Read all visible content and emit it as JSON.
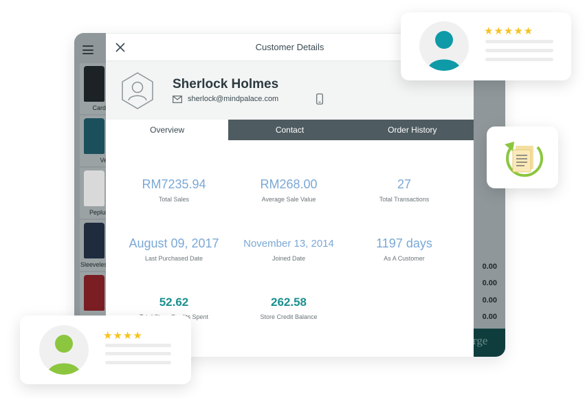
{
  "background_app": {
    "products": [
      {
        "label": "Cardi",
        "color": "#1c2226"
      },
      {
        "label": "Ve",
        "color": "#1b4f5c"
      },
      {
        "label": "Peplur",
        "color": "#d9d9d9"
      },
      {
        "label": "Sleeveles",
        "color": "#1f2c3e"
      },
      {
        "label": "",
        "color": "#7a1e23"
      }
    ],
    "values": [
      "0.00",
      "0.00",
      "0.00",
      "0.00"
    ],
    "charge_label": "rge"
  },
  "modal": {
    "title": "Customer Details",
    "customer": {
      "name": "Sherlock Holmes",
      "email": "sherlock@mindpalace.com"
    },
    "tabs": [
      {
        "label": "Overview",
        "active": true
      },
      {
        "label": "Contact",
        "active": false
      },
      {
        "label": "Order History",
        "active": false
      }
    ],
    "stats": [
      {
        "value": "RM7235.94",
        "label": "Total Sales"
      },
      {
        "value": "RM268.00",
        "label": "Average Sale Value"
      },
      {
        "value": "27",
        "label": "Total Transactions"
      },
      {
        "value": "August 09, 2017",
        "label": "Last Purchased Date"
      },
      {
        "value": "November 13, 2014",
        "label": "Joined Date"
      },
      {
        "value": "1197 days",
        "label": "As A Customer"
      },
      {
        "value": "52.62",
        "label": "Total Store Credits Spent"
      },
      {
        "value": "262.58",
        "label": "Store Credit Balance"
      }
    ]
  },
  "review_cards": {
    "top": {
      "stars": "★★★★★",
      "avatar_color": "#0e9aa7"
    },
    "bottom": {
      "stars": "★★★★",
      "avatar_color": "#8cc63f"
    }
  },
  "icons": {
    "close": "close-icon",
    "avatar": "user-hexagon-icon",
    "mail": "mail-icon",
    "phone": "phone-icon",
    "sync_document": "sync-document-icon",
    "menu": "hamburger-menu-icon"
  },
  "colors": {
    "stat_blue": "#7aa8d6",
    "stat_teal": "#1a8f8f",
    "tab_inactive": "#4e5b60",
    "star": "#f7c21f",
    "sync_green": "#8cc63f"
  }
}
